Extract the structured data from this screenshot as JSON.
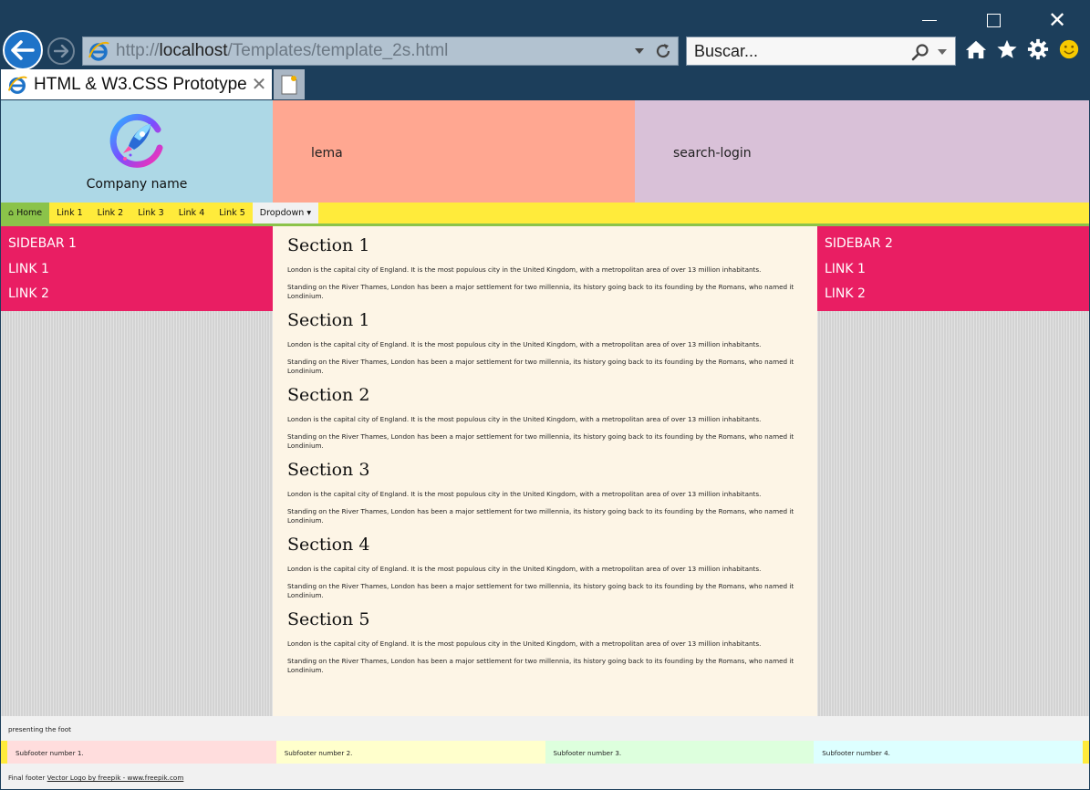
{
  "browser": {
    "address": {
      "scheme": "http://",
      "host": "localhost",
      "path": "/Templates/template_2s.html"
    },
    "search_placeholder": "Buscar...",
    "tab_title": "HTML & W3.CSS Prototype",
    "icons": [
      "back-arrow",
      "forward-arrow",
      "ie-logo",
      "dropdown-arrow",
      "refresh",
      "search",
      "home",
      "favorites-star",
      "settings-gear",
      "feedback-smiley",
      "new-tab",
      "minimize",
      "maximize",
      "close"
    ]
  },
  "header": {
    "company_name": "Company name",
    "lema": "lema",
    "search_login": "search-login"
  },
  "navbar": {
    "home": "Home",
    "links": [
      "Link 1",
      "Link 2",
      "Link 3",
      "Link 4",
      "Link 5"
    ],
    "dropdown": "Dropdown"
  },
  "sidebar1": {
    "title": "SIDEBAR 1",
    "links": [
      "LINK 1",
      "LINK 2"
    ]
  },
  "sidebar2": {
    "title": "SIDEBAR 2",
    "links": [
      "LINK 1",
      "LINK 2"
    ]
  },
  "sections": [
    {
      "title": "Section 1",
      "p1": "London is the capital city of England. It is the most populous city in the United Kingdom, with a metropolitan area of over 13 million inhabitants.",
      "p2": "Standing on the River Thames, London has been a major settlement for two millennia, its history going back to its founding by the Romans, who named it Londinium."
    },
    {
      "title": "Section 1",
      "p1": "London is the capital city of England. It is the most populous city in the United Kingdom, with a metropolitan area of over 13 million inhabitants.",
      "p2": "Standing on the River Thames, London has been a major settlement for two millennia, its history going back to its founding by the Romans, who named it Londinium."
    },
    {
      "title": "Section 2",
      "p1": "London is the capital city of England. It is the most populous city in the United Kingdom, with a metropolitan area of over 13 million inhabitants.",
      "p2": "Standing on the River Thames, London has been a major settlement for two millennia, its history going back to its founding by the Romans, who named it Londinium."
    },
    {
      "title": "Section 3",
      "p1": "London is the capital city of England. It is the most populous city in the United Kingdom, with a metropolitan area of over 13 million inhabitants.",
      "p2": "Standing on the River Thames, London has been a major settlement for two millennia, its history going back to its founding by the Romans, who named it Londinium."
    },
    {
      "title": "Section 4",
      "p1": "London is the capital city of England. It is the most populous city in the United Kingdom, with a metropolitan area of over 13 million inhabitants.",
      "p2": "Standing on the River Thames, London has been a major settlement for two millennia, its history going back to its founding by the Romans, who named it Londinium."
    },
    {
      "title": "Section 5",
      "p1": "London is the capital city of England. It is the most populous city in the United Kingdom, with a metropolitan area of over 13 million inhabitants.",
      "p2": "Standing on the River Thames, London has been a major settlement for two millennia, its history going back to its founding by the Romans, who named it Londinium."
    }
  ],
  "footer": {
    "foot": "presenting the foot",
    "subfooters": [
      "Subfooter number 1.",
      "Subfooter number 2.",
      "Subfooter number 3.",
      "Subfooter number 4."
    ],
    "final_prefix": "Final footer",
    "final_link": "Vector Logo by freepik - www.freepik.com"
  },
  "colors": {
    "chrome": "#1c3e5b",
    "header_logo": "#add8e6",
    "header_lema": "#ffa791",
    "header_search": "#d9c1d8",
    "navbar": "#ffeb3b",
    "nav_home": "#8bc34a",
    "sidebar_box": "#e91e63",
    "main_bg": "#fdf5e6"
  }
}
